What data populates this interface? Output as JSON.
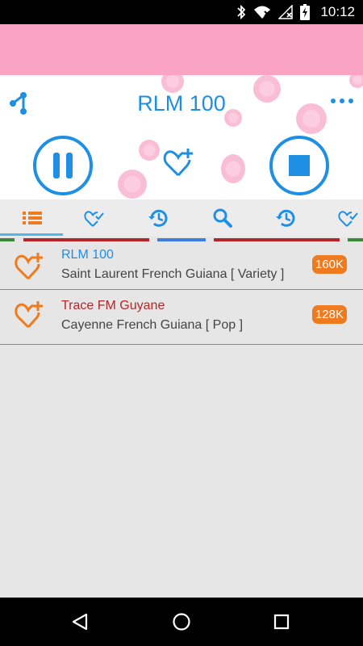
{
  "status_bar": {
    "time": "10:12",
    "icons": [
      "bluetooth-icon",
      "wifi-icon",
      "signal-icon",
      "battery-charging-icon"
    ]
  },
  "player": {
    "station_title": "RLM 100",
    "controls": [
      "share-icon",
      "more-icon",
      "pause-icon",
      "favorite-add-icon",
      "stop-icon"
    ]
  },
  "tabs": [
    {
      "icon": "list-icon",
      "selected": true,
      "color": "#f07a1e"
    },
    {
      "icon": "favorite-check-icon",
      "color": "#1e8fe3"
    },
    {
      "icon": "history-icon",
      "color": "#1e8fe3"
    },
    {
      "icon": "search-icon",
      "color": "#1e8fe3"
    },
    {
      "icon": "history-icon",
      "color": "#1e8fe3"
    },
    {
      "icon": "favorite-check-icon",
      "color": "#1e8fe3"
    }
  ],
  "stations": [
    {
      "name": "RLM 100",
      "name_color": "#1e8fe3",
      "description": "Saint Laurent French Guiana [ Variety ]",
      "bitrate": "160K"
    },
    {
      "name": "Trace FM Guyane",
      "name_color": "#b3262a",
      "description": "Cayenne French Guiana [ Pop ]",
      "bitrate": "128K"
    }
  ],
  "colors": {
    "accent_blue": "#1e8fe3",
    "accent_orange": "#f07a1e",
    "pink": "#fba3c3",
    "tab_red": "#b3262a",
    "tab_green": "#3b8a3a"
  },
  "nav_bar": [
    "back-icon",
    "home-icon",
    "recents-icon"
  ]
}
